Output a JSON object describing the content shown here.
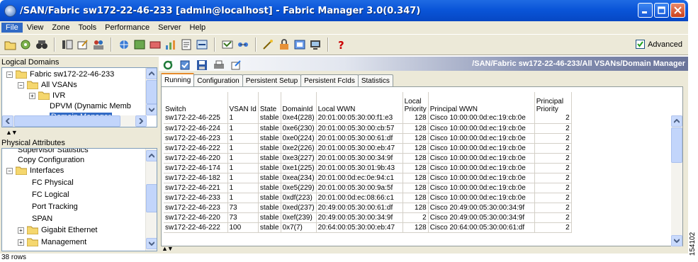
{
  "window": {
    "title": "/SAN/Fabric sw172-22-46-233 [admin@localhost] - Fabric Manager 3.0(0.347)",
    "controls": [
      "minimize-icon",
      "maximize-icon",
      "close-icon"
    ]
  },
  "menu": [
    "File",
    "View",
    "Zone",
    "Tools",
    "Performance",
    "Server",
    "Help"
  ],
  "toolbar": {
    "advanced_label": "Advanced",
    "advanced_checked": true
  },
  "logical_domains": {
    "title": "Logical Domains",
    "items": [
      {
        "label": "Fabric sw172-22-46-233",
        "expander": "−"
      },
      {
        "label": "All VSANs",
        "expander": "−"
      },
      {
        "label": "IVR",
        "expander": "+"
      },
      {
        "label": "DPVM (Dynamic Memb"
      },
      {
        "label": "Domain Manager",
        "selected": true
      }
    ]
  },
  "physical_attributes": {
    "title": "Physical Attributes",
    "items": [
      {
        "label": "Supervisor Statistics"
      },
      {
        "label": "Copy Configuration"
      },
      {
        "label": "Interfaces",
        "expander": "−"
      },
      {
        "label": "FC Physical"
      },
      {
        "label": "FC Logical"
      },
      {
        "label": "Port Tracking"
      },
      {
        "label": "SPAN"
      },
      {
        "label": "Gigabit Ethernet",
        "expander": "+"
      },
      {
        "label": "Management",
        "expander": "+"
      }
    ]
  },
  "content": {
    "path": "/SAN/Fabric sw172-22-46-233/All VSANs/Domain Manager",
    "tabs": [
      "Running",
      "Configuration",
      "Persistent Setup",
      "Persistent FcIds",
      "Statistics"
    ],
    "active_tab": "Running",
    "columns": [
      "Switch",
      "VSAN Id",
      "State",
      "DomainId",
      "Local WWN",
      "Local\nPriority",
      "Principal WWN",
      "Principal\nPriority"
    ],
    "rows": [
      [
        "sw172-22-46-225",
        "1",
        "stable",
        "0xe4(228)",
        "20:01:00:05:30:00:f1:e3",
        "128",
        "Cisco 10:00:00:0d:ec:19:cb:0e",
        "2"
      ],
      [
        "sw172-22-46-224",
        "1",
        "stable",
        "0xe6(230)",
        "20:01:00:05:30:00:cb:57",
        "128",
        "Cisco 10:00:00:0d:ec:19:cb:0e",
        "2"
      ],
      [
        "sw172-22-46-223",
        "1",
        "stable",
        "0xe0(224)",
        "20:01:00:05:30:00:61:df",
        "128",
        "Cisco 10:00:00:0d:ec:19:cb:0e",
        "2"
      ],
      [
        "sw172-22-46-222",
        "1",
        "stable",
        "0xe2(226)",
        "20:01:00:05:30:00:eb:47",
        "128",
        "Cisco 10:00:00:0d:ec:19:cb:0e",
        "2"
      ],
      [
        "sw172-22-46-220",
        "1",
        "stable",
        "0xe3(227)",
        "20:01:00:05:30:00:34:9f",
        "128",
        "Cisco 10:00:00:0d:ec:19:cb:0e",
        "2"
      ],
      [
        "sw172-22-46-174",
        "1",
        "stable",
        "0xe1(225)",
        "20:01:00:05:30:01:9b:43",
        "128",
        "Cisco 10:00:00:0d:ec:19:cb:0e",
        "2"
      ],
      [
        "sw172-22-46-182",
        "1",
        "stable",
        "0xea(234)",
        "20:01:00:0d:ec:0e:94:c1",
        "128",
        "Cisco 10:00:00:0d:ec:19:cb:0e",
        "2"
      ],
      [
        "sw172-22-46-221",
        "1",
        "stable",
        "0xe5(229)",
        "20:01:00:05:30:00:9a:5f",
        "128",
        "Cisco 10:00:00:0d:ec:19:cb:0e",
        "2"
      ],
      [
        "sw172-22-46-233",
        "1",
        "stable",
        "0xdf(223)",
        "20:01:00:0d:ec:08:66:c1",
        "128",
        "Cisco 10:00:00:0d:ec:19:cb:0e",
        "2"
      ],
      [
        "sw172-22-46-223",
        "73",
        "stable",
        "0xed(237)",
        "20:49:00:05:30:00:61:df",
        "128",
        "Cisco 20:49:00:05:30:00:34:9f",
        "2"
      ],
      [
        "sw172-22-46-220",
        "73",
        "stable",
        "0xef(239)",
        "20:49:00:05:30:00:34:9f",
        "2",
        "Cisco 20:49:00:05:30:00:34:9f",
        "2"
      ],
      [
        "sw172-22-46-222",
        "100",
        "stable",
        "0x7(7)",
        "20:64:00:05:30:00:eb:47",
        "128",
        "Cisco 20:64:00:05:30:00:61:df",
        "2"
      ]
    ]
  },
  "status": "38 rows",
  "figure_id": "154102"
}
